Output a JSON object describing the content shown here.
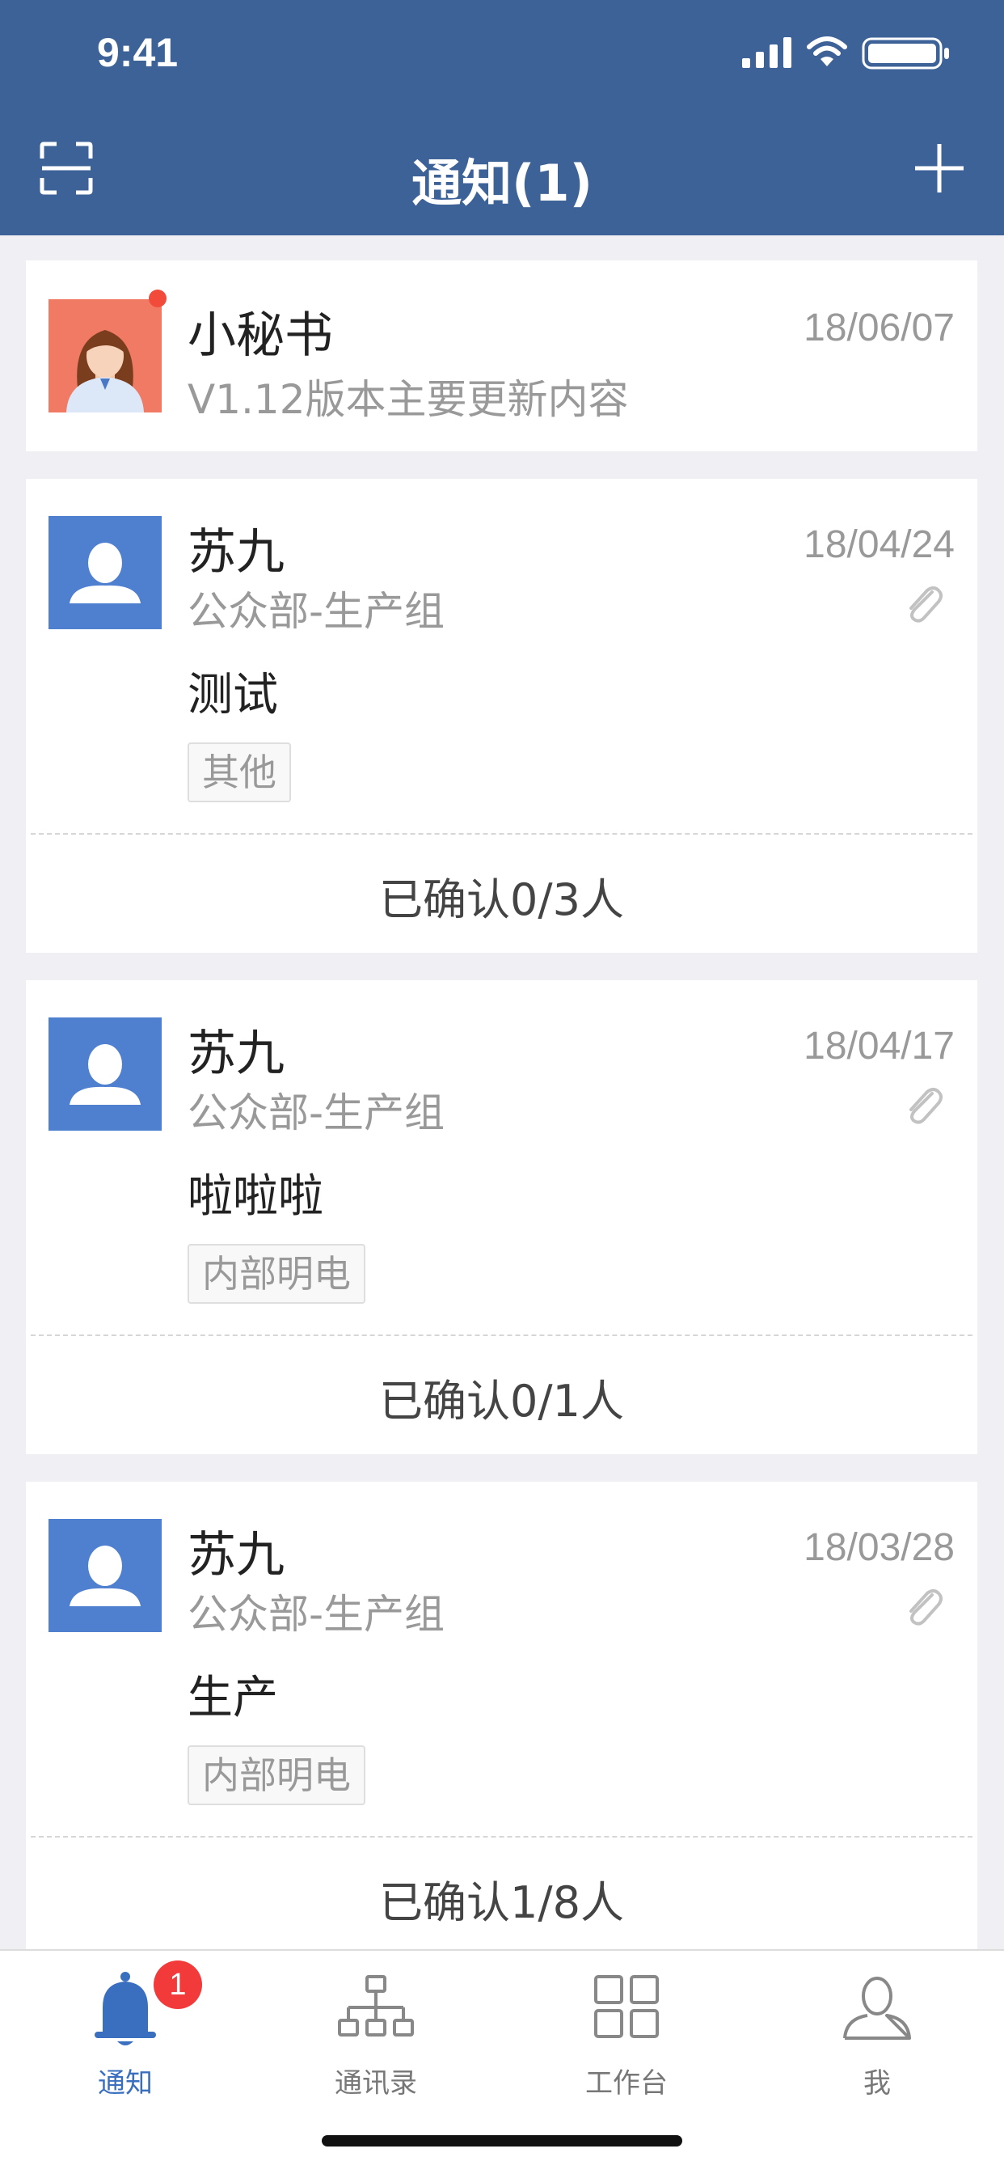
{
  "status_bar": {
    "time": "9:41"
  },
  "nav": {
    "title": "通知(1)"
  },
  "secretary": {
    "name": "小秘书",
    "date": "18/06/07",
    "subtitle": "V1.12版本主要更新内容"
  },
  "notices": [
    {
      "sender": "苏九",
      "date": "18/04/24",
      "department": "公众部-生产组",
      "title": "测试",
      "tag": "其他",
      "confirm": "已确认0/3人"
    },
    {
      "sender": "苏九",
      "date": "18/04/17",
      "department": "公众部-生产组",
      "title": "啦啦啦",
      "tag": "内部明电",
      "confirm": "已确认0/1人"
    },
    {
      "sender": "苏九",
      "date": "18/03/28",
      "department": "公众部-生产组",
      "title": "生产",
      "tag": "内部明电",
      "confirm": "已确认1/8人"
    }
  ],
  "tabbar": {
    "tabs": [
      {
        "label": "通知",
        "icon": "bell-icon",
        "badge": "1",
        "active": true
      },
      {
        "label": "通讯录",
        "icon": "org-chart-icon",
        "active": false
      },
      {
        "label": "工作台",
        "icon": "grid-icon",
        "active": false
      },
      {
        "label": "我",
        "icon": "person-icon",
        "active": false
      }
    ]
  },
  "colors": {
    "header_bg": "#3d6298",
    "page_bg": "#efeff4",
    "avatar_blue": "#4f7fcf",
    "secretary_avatar_bg": "#f07a63",
    "active_tab": "#3a6fc0",
    "badge_red": "#f23a3a"
  }
}
